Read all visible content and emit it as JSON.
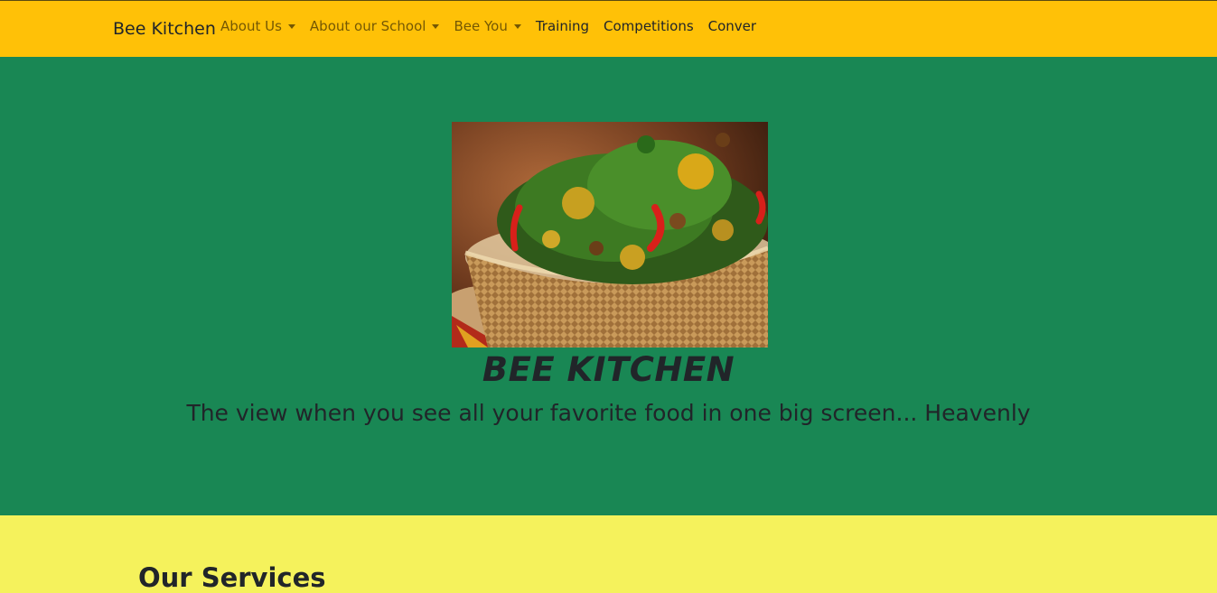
{
  "navbar": {
    "brand": "Bee Kitchen",
    "items": [
      {
        "label": "About Us",
        "dropdown": true
      },
      {
        "label": "About our School",
        "dropdown": true
      },
      {
        "label": "Bee You",
        "dropdown": true
      },
      {
        "label": "Training",
        "dropdown": false
      },
      {
        "label": "Competitions",
        "dropdown": false
      },
      {
        "label": "Conver",
        "dropdown": false
      }
    ]
  },
  "hero": {
    "image_alt": "dish of vegetable soup with peppers in a glass bowl",
    "title": "BEE KITCHEN",
    "subtitle": "The view when you see all your favorite food in one big screen... Heavenly"
  },
  "services": {
    "title": "Our Services"
  },
  "colors": {
    "navbar_bg": "#ffc107",
    "hero_bg": "#198754",
    "services_bg": "#f5f25c"
  }
}
